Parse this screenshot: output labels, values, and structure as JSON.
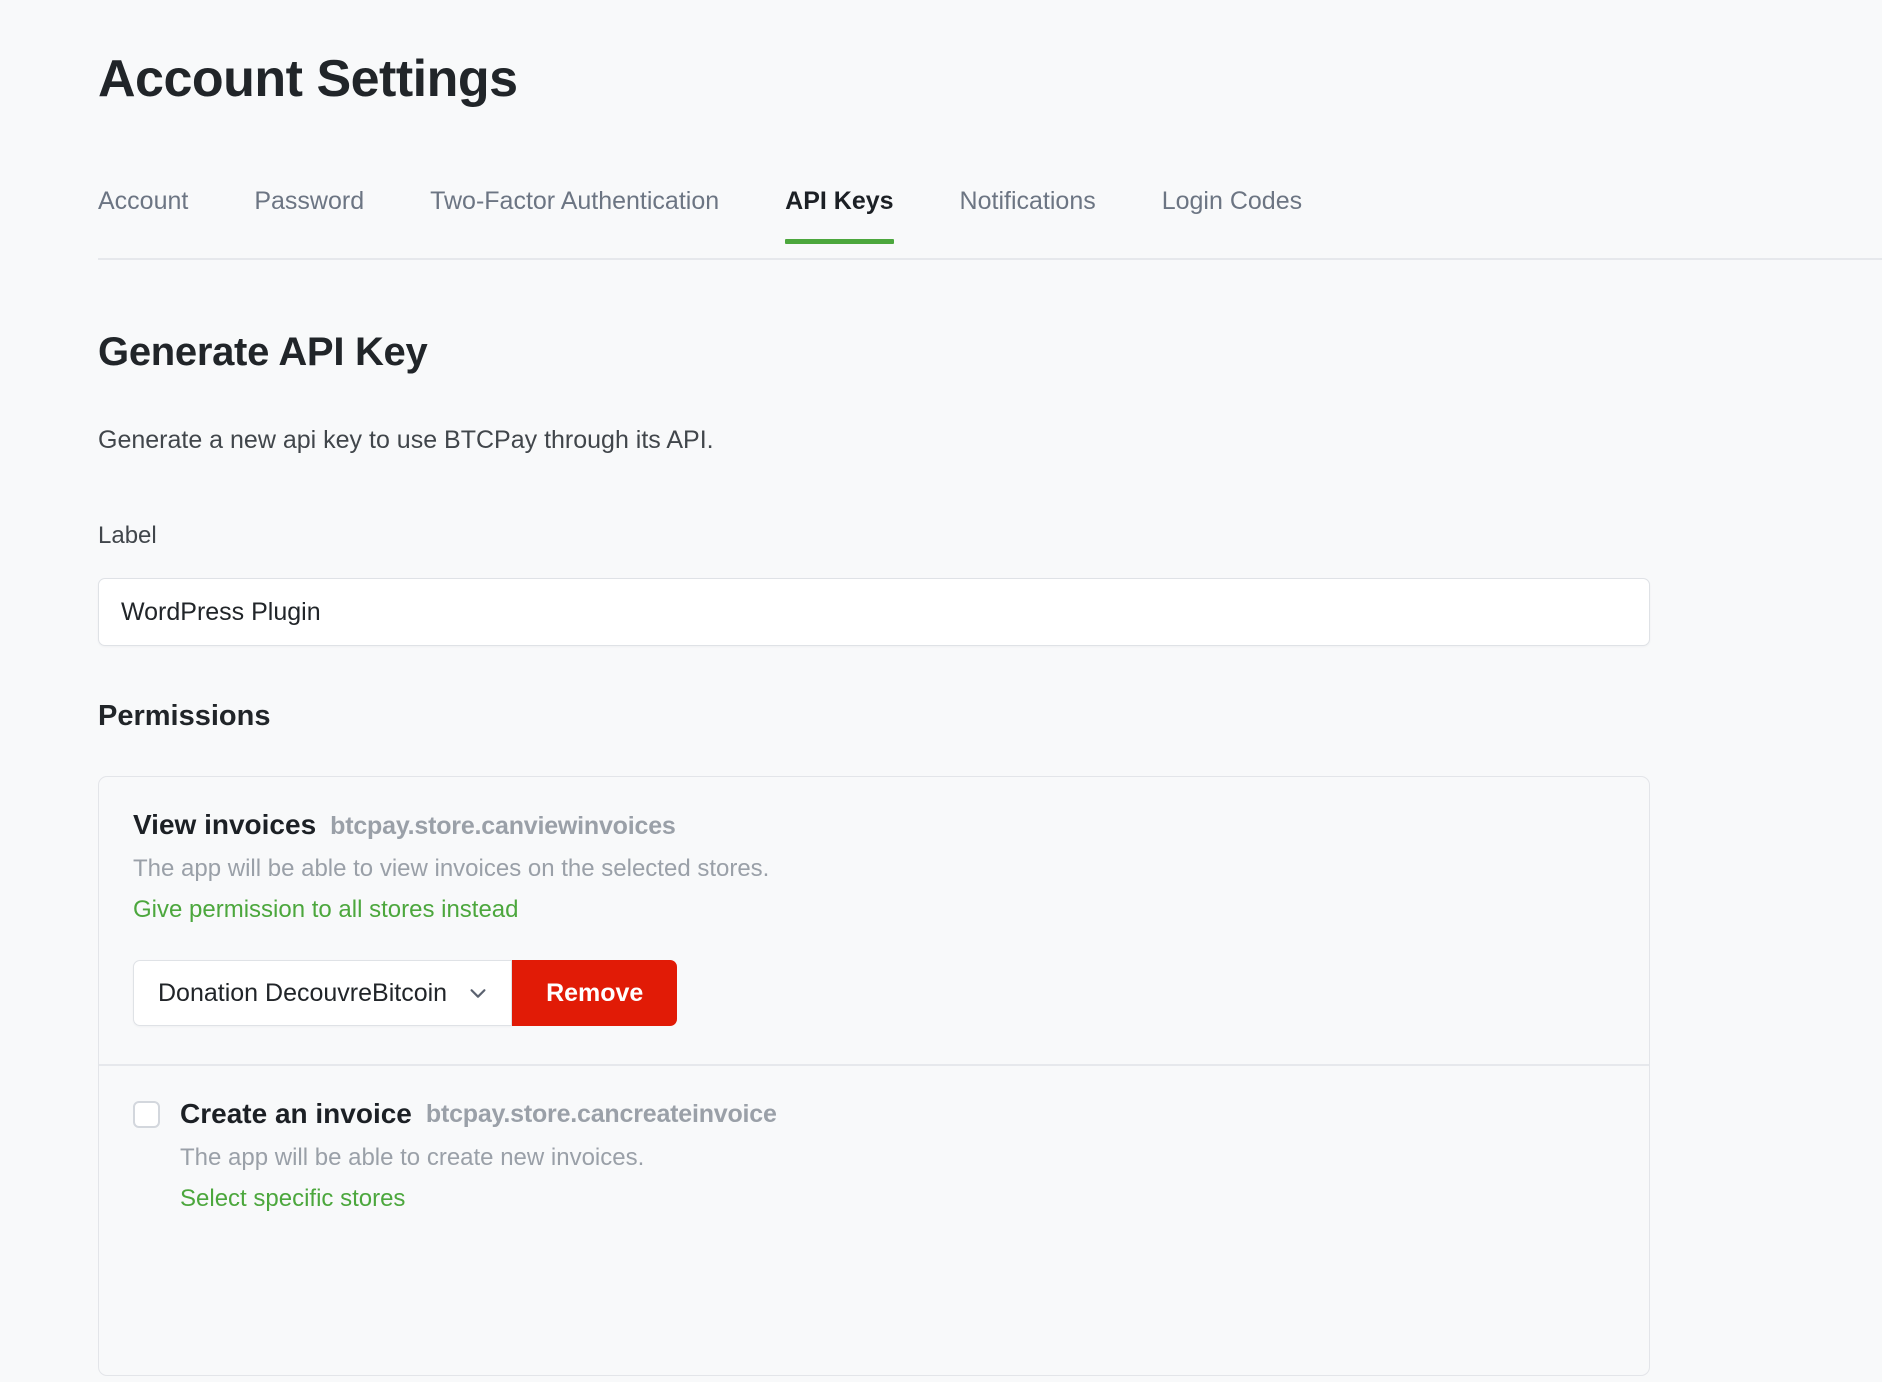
{
  "theme": {
    "accent": "#4ca73d",
    "danger": "#e11b06",
    "page_bg": "#f8f9fa",
    "text": "#212529",
    "muted": "#9aa0a8"
  },
  "header": {
    "title": "Account Settings"
  },
  "tabs": [
    {
      "label": "Account",
      "active": false
    },
    {
      "label": "Password",
      "active": false
    },
    {
      "label": "Two-Factor Authentication",
      "active": false
    },
    {
      "label": "API Keys",
      "active": true
    },
    {
      "label": "Notifications",
      "active": false
    },
    {
      "label": "Login Codes",
      "active": false
    }
  ],
  "main": {
    "section_title": "Generate API Key",
    "section_desc": "Generate a new api key to use BTCPay through its API.",
    "label_text": "Label",
    "label_value": "WordPress Plugin",
    "label_placeholder": "",
    "permissions_heading": "Permissions"
  },
  "permissions": [
    {
      "name": "View invoices",
      "code": "btcpay.store.canviewinvoices",
      "description": "The app will be able to view invoices on the selected stores.",
      "link": "Give permission to all stores instead",
      "has_checkbox": false,
      "checked": false,
      "store": {
        "selected": "Donation DecouvreBitcoin",
        "remove_label": "Remove"
      }
    },
    {
      "name": "Create an invoice",
      "code": "btcpay.store.cancreateinvoice",
      "description": "The app will be able to create new invoices.",
      "link": "Select specific stores",
      "has_checkbox": true,
      "checked": false,
      "store": null
    }
  ]
}
